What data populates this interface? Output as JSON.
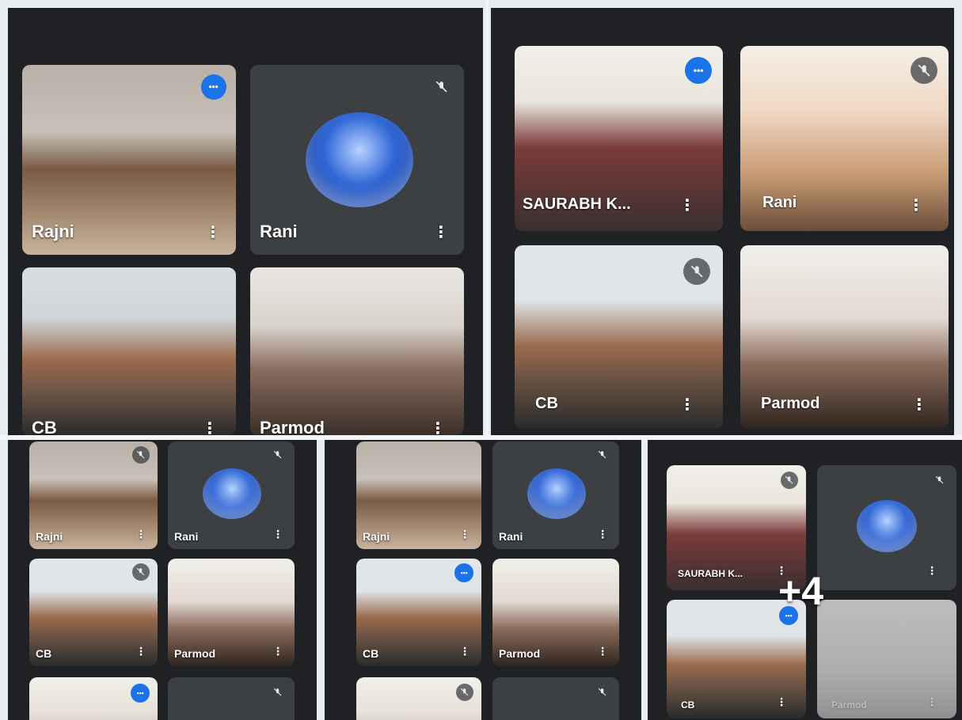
{
  "participants": {
    "rajni": "Rajni",
    "rani": "Rani",
    "cb": "CB",
    "parmod": "Parmod",
    "saurabh": "SAURABH K..."
  },
  "tile_menu_glyph": "⋮",
  "overflow": {
    "label": "+4"
  },
  "colors": {
    "meet_bg": "#202124",
    "speaking_blue": "#1a73e8",
    "muted_bg": "#5f6368"
  },
  "icons": [
    "mic-off-icon",
    "speaking-indicator-icon",
    "more-options-icon",
    "avatar-image"
  ]
}
